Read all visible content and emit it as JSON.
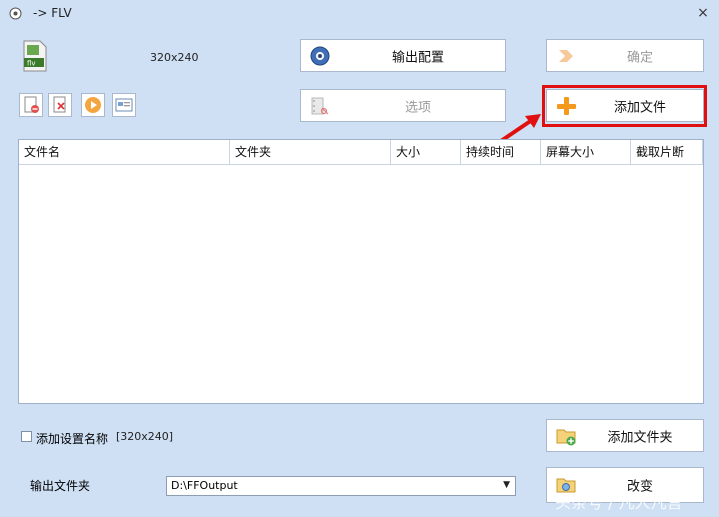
{
  "window": {
    "title": "-> FLV",
    "close_symbol": "×"
  },
  "profile": {
    "resolution": "320x240",
    "format_icon": "flv-file-icon"
  },
  "buttons": {
    "output_config": {
      "label": "输出配置",
      "icon": "gear-icon"
    },
    "confirm": {
      "label": "确定",
      "icon": "arrow-right-icon"
    },
    "options": {
      "label": "选项",
      "icon": "film-scissors-icon"
    },
    "add_file": {
      "label": "添加文件",
      "icon": "plus-icon"
    },
    "add_folder": {
      "label": "添加文件夹",
      "icon": "folder-add-icon"
    },
    "change": {
      "label": "改变",
      "icon": "folder-open-icon"
    }
  },
  "toolbar": {
    "tools": [
      {
        "name": "remove-tool",
        "icon": "remove-icon"
      },
      {
        "name": "clear-tool",
        "icon": "clear-icon"
      },
      {
        "name": "play-tool",
        "icon": "play-icon"
      },
      {
        "name": "info-tool",
        "icon": "media-info-icon"
      }
    ]
  },
  "file_list": {
    "columns": [
      "文件名",
      "文件夹",
      "大小",
      "持续时间",
      "屏幕大小",
      "截取片断"
    ]
  },
  "settings": {
    "add_setting_name_label": "添加设置名称",
    "add_setting_name_detail": "[320x240]",
    "add_setting_name_checked": false
  },
  "output": {
    "label": "输出文件夹",
    "path": "D:\\FFOutput"
  },
  "watermark": "头条号 / 凡人凡言",
  "colors": {
    "highlight": "#e01010",
    "background": "#cfe0f5",
    "accent_plus": "#f39a1e"
  }
}
